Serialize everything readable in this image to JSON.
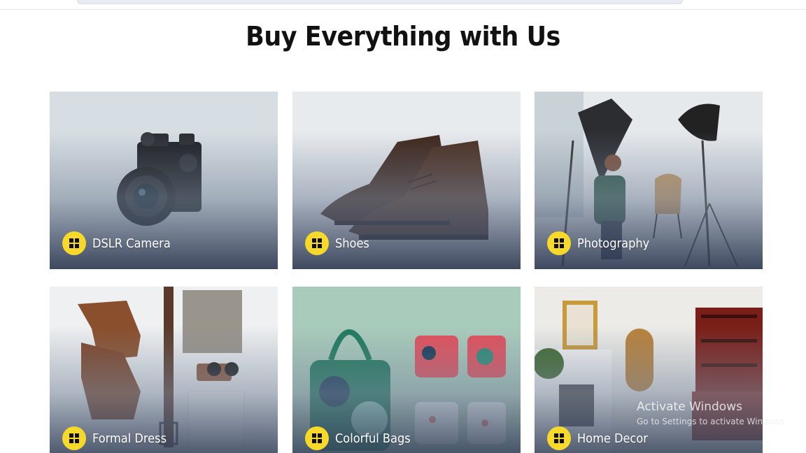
{
  "page": {
    "title": "Buy Everything with Us"
  },
  "categories": [
    {
      "label": "DSLR Camera",
      "icon": "windows-icon"
    },
    {
      "label": "Shoes",
      "icon": "windows-icon"
    },
    {
      "label": "Photography",
      "icon": "windows-icon"
    },
    {
      "label": "Formal Dress",
      "icon": "windows-icon"
    },
    {
      "label": "Colorful Bags",
      "icon": "windows-icon"
    },
    {
      "label": "Home Decor",
      "icon": "windows-icon"
    }
  ],
  "watermark": {
    "title": "Activate Windows",
    "subtitle": "Go to Settings to activate Windows."
  },
  "colors": {
    "badge": "#f7d92b",
    "overlay_bottom": "#303c54",
    "title": "#111111"
  }
}
